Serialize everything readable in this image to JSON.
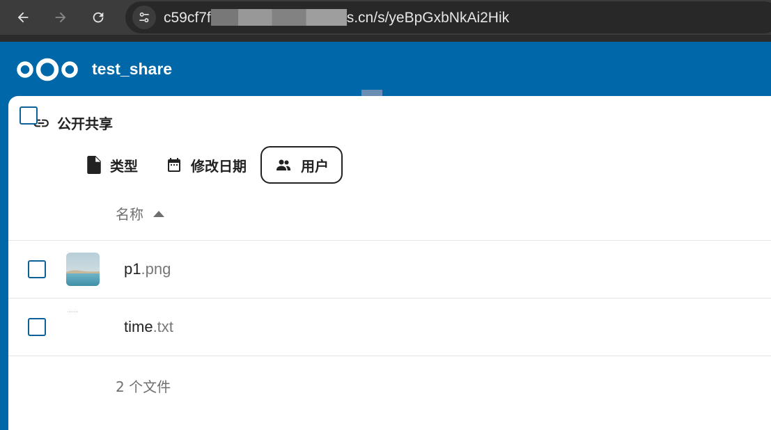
{
  "browser": {
    "url_prefix": "c59cf7f",
    "url_suffix": "s.cn/s/yeBpGxbNkAi2Hik"
  },
  "header": {
    "share_name": "test_share"
  },
  "section": {
    "title": "公开共享"
  },
  "filters": [
    {
      "label": "类型",
      "icon": "file-icon",
      "active": false
    },
    {
      "label": "修改日期",
      "icon": "calendar-icon",
      "active": false
    },
    {
      "label": "用户",
      "icon": "users-icon",
      "active": true
    }
  ],
  "list": {
    "column_name": "名称",
    "rows": [
      {
        "base": "p1",
        "ext": ".png",
        "thumb": "image"
      },
      {
        "base": "time",
        "ext": ".txt",
        "thumb": "text"
      }
    ],
    "summary": "2 个文件"
  },
  "colors": {
    "brand": "#0068a8",
    "checkbox": "#0b6195"
  }
}
